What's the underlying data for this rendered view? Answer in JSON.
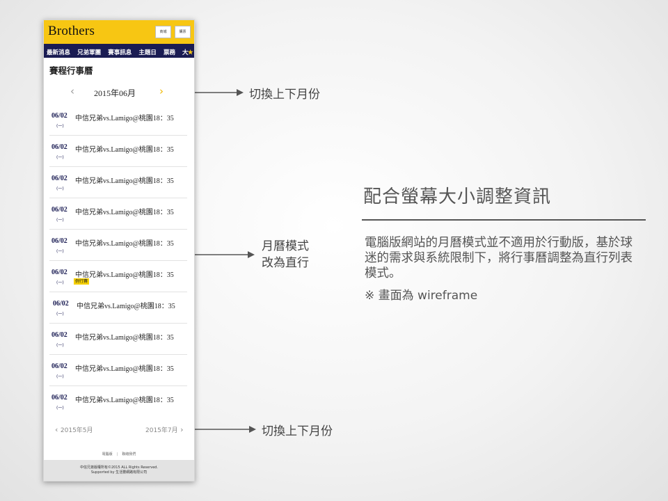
{
  "app": {
    "logo": "Brothers",
    "top_buttons": [
      "商城",
      "購票"
    ],
    "nav_items": [
      "最新消息",
      "兄弟軍團",
      "賽事訊息",
      "主題日",
      "票務",
      "大"
    ],
    "page_title": "賽程行事曆"
  },
  "month_nav": {
    "prev_icon": "chevron-left-icon",
    "label": "2015年06月",
    "next_icon": "chevron-right-icon"
  },
  "games": [
    {
      "date": "06/02",
      "title": "中信兄弟vs.Lamigo@桃園18：35",
      "day": "(一)",
      "tag": ""
    },
    {
      "date": "06/02",
      "title": "中信兄弟vs.Lamigo@桃園18：35",
      "day": "(一)",
      "tag": ""
    },
    {
      "date": "06/02",
      "title": "中信兄弟vs.Lamigo@桃園18：35",
      "day": "(一)",
      "tag": ""
    },
    {
      "date": "06/02",
      "title": "中信兄弟vs.Lamigo@桃園18：35",
      "day": "(一)",
      "tag": ""
    },
    {
      "date": "06/02",
      "title": "中信兄弟vs.Lamigo@桃園18：35",
      "day": "(一)",
      "tag": ""
    },
    {
      "date": "06/02",
      "title": "中信兄弟vs.Lamigo@桃園18：35",
      "day": "(一)",
      "tag": "例行賽"
    },
    {
      "date": "06/02",
      "title": "中信兄弟vs.Lamigo@桃園18：35",
      "day": "(一)",
      "tag": ""
    },
    {
      "date": "06/02",
      "title": "中信兄弟vs.Lamigo@桃園18：35",
      "day": "(一)",
      "tag": ""
    },
    {
      "date": "06/02",
      "title": "中信兄弟vs.Lamigo@桃園18：35",
      "day": "(一)",
      "tag": ""
    },
    {
      "date": "06/02",
      "title": "中信兄弟vs.Lamigo@桃園18：35",
      "day": "(一)",
      "tag": ""
    }
  ],
  "pager": {
    "prev": "2015年5月",
    "next": "2015年7月"
  },
  "footer": {
    "links": [
      "電腦版",
      "聯絡我們"
    ],
    "copyright_1": "中信兄弟版權所有©2015 ALL Rights Reserved.",
    "copyright_2": "Supported by 生活豐網路有限公司"
  },
  "annotations": {
    "month_switch_top": "切換上下月份",
    "calendar_mode": [
      "月曆模式",
      "改為直行"
    ],
    "month_switch_bottom": "切換上下月份"
  },
  "slide": {
    "heading": "配合螢幕大小調整資訊",
    "description": "電腦版網站的月曆模式並不適用於行動版，基於球迷的需求與系統限制下，將行事曆調整為直行列表模式。",
    "note": "※ 畫面為 wireframe"
  },
  "colors": {
    "brand_yellow": "#f7c613",
    "nav_navy": "#1a1c53"
  }
}
